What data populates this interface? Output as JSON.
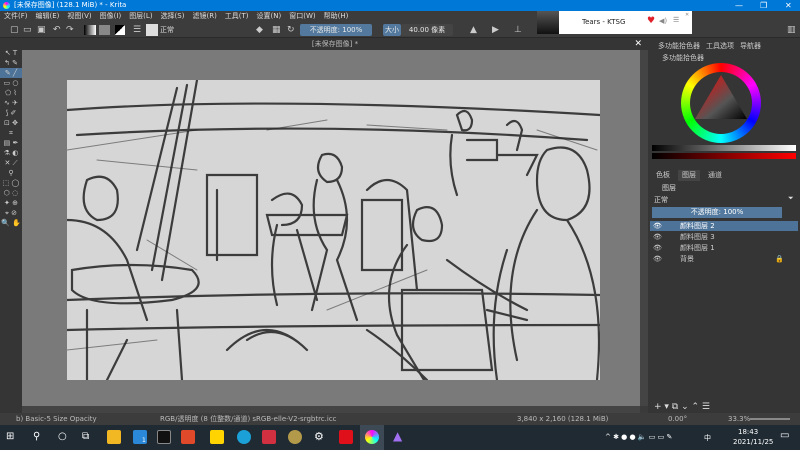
{
  "window": {
    "title": "[未保存图像]  (128.1 MiB)  * - Krita"
  },
  "menu": [
    "文件(F)",
    "编辑(E)",
    "视图(V)",
    "图像(I)",
    "图层(L)",
    "选择(S)",
    "滤镜(R)",
    "工具(T)",
    "设置(N)",
    "窗口(W)",
    "帮助(H)"
  ],
  "toolbar": {
    "blend_mode": "正常",
    "opacity": "不透明度: 100%",
    "size_label": "大小",
    "size": "40.00 像素"
  },
  "media": {
    "track": "Tears - KTSG",
    "heart_color": "#e0202a"
  },
  "canvas": {
    "tab_title": "[未保存图像] *"
  },
  "dock": {
    "top_tabs": [
      "多功能拾色器",
      "工具选项",
      "导航器"
    ],
    "color_panel_title": "多功能拾色器",
    "layer_tabs": [
      "色板",
      "图层",
      "通道"
    ],
    "layers_title": "图层",
    "blend_mode": "正常",
    "opacity": "不透明度: 100%",
    "layers": [
      {
        "name": "颜料图层 2",
        "selected": true
      },
      {
        "name": "颜料图层 3"
      },
      {
        "name": "颜料图层 1"
      },
      {
        "name": "背景",
        "locked": true
      }
    ]
  },
  "status": {
    "brush": "b) Basic-5 Size Opacity",
    "color_space": "RGB/透明度 (8 位整数/通道)  sRGB-elle-V2-srgbtrc.icc",
    "dimensions": "3,840 x 2,160 (128.1 MiB)",
    "rotation": "0.00°",
    "zoom": "33.3%"
  },
  "taskbar": {
    "mail_badge": "1",
    "time": "18:43",
    "date": "2021/11/25",
    "ime": "中"
  }
}
